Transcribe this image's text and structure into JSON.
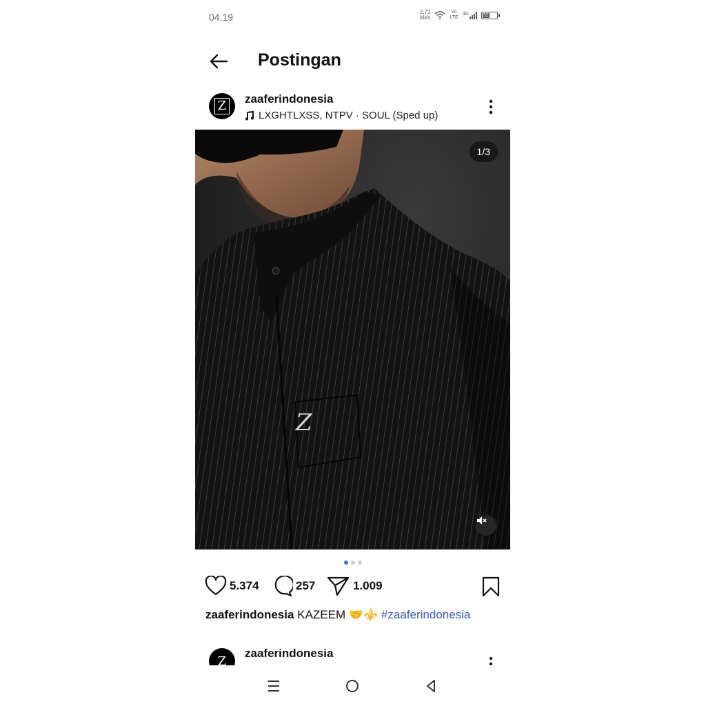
{
  "status_bar": {
    "time": "04.19",
    "net_speed_value": "2,73",
    "net_speed_unit": "kb/s",
    "volte_top": "Vo",
    "volte_bottom": "LTE",
    "network": "4G",
    "battery": "52"
  },
  "header": {
    "title": "Postingan"
  },
  "post": {
    "username": "zaaferindonesia",
    "avatar_letter": "Z",
    "audio": "LXGHTLXSS, NTPV · SOUL (Sped up)",
    "media_counter": "1/3",
    "carousel_index": 1,
    "carousel_total": 3,
    "likes": "5.374",
    "comments": "257",
    "shares": "1.009",
    "caption_username": "zaaferindonesia",
    "caption_text": "KAZEEM 🤝⚜️",
    "caption_hashtag": "#zaaferindonesia",
    "badge_letter": "Z"
  },
  "next_post": {
    "username": "zaaferindonesia",
    "avatar_letter": "Z"
  },
  "colors": {
    "accent": "#3b6dea",
    "hashtag": "#3a58c4",
    "media_bg": "#1b1b1c"
  }
}
